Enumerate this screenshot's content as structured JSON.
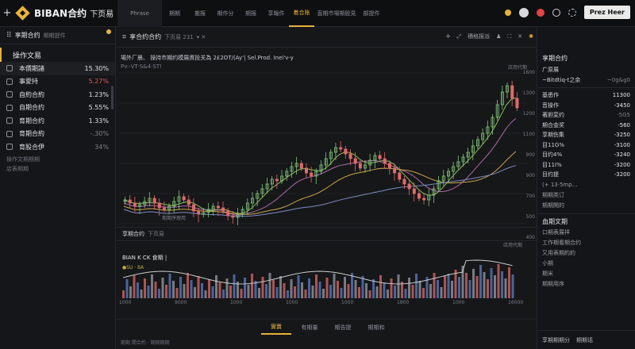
{
  "topbar": {
    "plus": "+",
    "logo": "BIBAN合约",
    "logo_sub": "下页易",
    "tabs": [
      "Phrase",
      "期期",
      "搬报",
      "期作分",
      "期报",
      "享報件",
      "着合账",
      "直期市場期股見",
      "部提件"
    ],
    "active_tab": 6,
    "cta": "Prez Heer"
  },
  "left": {
    "head_title": "享期合约",
    "head_sub": "期期提件",
    "section": "操作文易",
    "rows": [
      {
        "label": "本價期諸",
        "value": "15.30%",
        "tone": "normal",
        "icon": "document-icon"
      },
      {
        "label": "事愛持",
        "value": "5.27%",
        "tone": "red",
        "icon": "grid-icon"
      },
      {
        "label": "自約合約",
        "value": "1.23%",
        "tone": "normal",
        "icon": "chart-icon"
      },
      {
        "label": "自期合约",
        "value": "5.55%",
        "tone": "normal",
        "icon": "calendar-icon"
      },
      {
        "label": "育期合约",
        "value": "1.33%",
        "tone": "normal",
        "icon": "link-icon"
      },
      {
        "label": "育期合約",
        "value": "-.30%",
        "tone": "dim",
        "icon": "box-icon"
      },
      {
        "label": "育股合伊",
        "value": "34%",
        "tone": "dim",
        "icon": "tag-icon"
      }
    ],
    "note1": "操作文期期期",
    "note2": "店表期期"
  },
  "main": {
    "symbol": "享合约合约",
    "symbol_sub": "下页易 231",
    "info_line1": "場外厂晨、 操持市期约模展資投关為 2£2OT/(Ay'| Sel.Prod. Inei'v-y",
    "info_line2": "Pv:·VT·S&4·ST!",
    "corner_label": "店用代期",
    "annotation": "期期序理用",
    "right_tool_label": "積格报派",
    "subheader_title": "享期合约",
    "subheader_sub": "下页易",
    "vol_title": "BIAN K CK 食期 |",
    "vol_legend": "●SU · 8A",
    "vol_corner": "店用代期",
    "bottom_tabs": [
      "實賣",
      "有期量",
      "期告提",
      "期期和"
    ],
    "active_bottom_tab": 0,
    "bottom_status": "期期 開合約 · 期期期期"
  },
  "right": {
    "title": "享期合约",
    "top_rows": [
      {
        "k": "广原展",
        "v": ""
      },
      {
        "k": "~Bitdtiq-t之余",
        "v": "~0g&g0",
        "dim": true
      }
    ],
    "rows": [
      {
        "k": "基悉作",
        "v": "11300"
      },
      {
        "k": "音操作",
        "v": "-3450"
      },
      {
        "k": "著胆変约",
        "v": "·5G5",
        "dim": true
      },
      {
        "k": "期合金奖",
        "v": "-560"
      },
      {
        "k": "享期伤集",
        "v": "-3250"
      },
      {
        "k": "目11G%",
        "v": "-3100"
      },
      {
        "k": "目约4%",
        "v": "-3240"
      },
      {
        "k": "目11I%",
        "v": "-3200"
      },
      {
        "k": "目约提",
        "v": "-3200"
      }
    ],
    "misc": [
      "(+ 13·5mp…",
      "期期类订",
      "期期開的"
    ],
    "section2": "血期文期",
    "items2": [
      "口期表展祥",
      "工作期看期合约",
      "又用表期約約",
      "小期",
      "期米",
      "期期用序"
    ],
    "footer_tabs": [
      "享期期期分",
      "期期话"
    ]
  },
  "chart_data": {
    "type": "candlestick",
    "y_axis_ticks": [
      "1600",
      "1300",
      "1200",
      "1100",
      "900",
      "900",
      "700",
      "500",
      "400"
    ],
    "x_axis_ticks": [
      "1000",
      "9000",
      "1000",
      "1000",
      "1000",
      "1800",
      "1000",
      "16000"
    ],
    "series": [
      {
        "name": "MA-green",
        "color": "#8fbf5a"
      },
      {
        "name": "MA-purple",
        "color": "#a86aa8"
      },
      {
        "name": "MA-gold",
        "color": "#c9a54a"
      },
      {
        "name": "MA-blue",
        "color": "#7f8bc0"
      }
    ],
    "close": [
      40,
      38,
      36,
      37,
      39,
      41,
      38,
      35,
      34,
      36,
      39,
      42,
      40,
      37,
      33,
      31,
      32,
      34,
      36,
      35,
      33,
      30,
      29,
      31,
      34,
      38,
      41,
      44,
      47,
      50,
      53,
      52,
      55,
      58,
      61,
      63,
      60,
      57,
      55,
      58,
      62,
      66,
      70,
      73,
      72,
      69,
      66,
      63,
      60,
      62,
      65,
      68,
      66,
      63,
      60,
      57,
      53,
      50,
      47,
      44,
      41,
      40,
      43,
      47,
      52,
      55,
      58,
      61,
      64,
      67,
      70,
      74,
      78,
      82,
      86,
      92,
      100,
      108,
      112,
      104,
      98
    ]
  }
}
